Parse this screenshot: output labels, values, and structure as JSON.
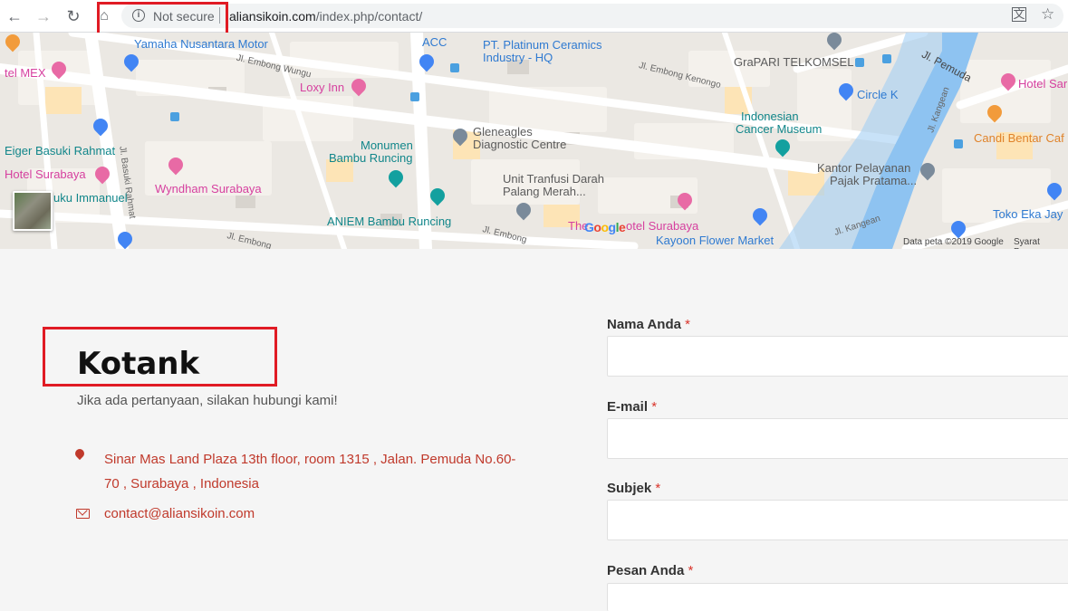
{
  "browser": {
    "security_label": "Not secure",
    "url_host": "aliansikoin.com",
    "url_path": "/index.php/contact/"
  },
  "map": {
    "places": [
      {
        "label": "Yamaha Nusantara Motor"
      },
      {
        "label": "ACC"
      },
      {
        "label": "PT. Platinum Ceramics"
      },
      {
        "label": "Industry - HQ"
      },
      {
        "label": "GraPARI TELKOMSEL"
      },
      {
        "label": "Jl. Pemuda"
      },
      {
        "label": "Hotel Sar"
      },
      {
        "label": "tel MEX"
      },
      {
        "label": "Loxy Inn"
      },
      {
        "label": "Circle K"
      },
      {
        "label": "Indonesian"
      },
      {
        "label": "Cancer Museum"
      },
      {
        "label": "Gleneagles"
      },
      {
        "label": "Diagnostic Centre"
      },
      {
        "label": "Candi Bentar Caf"
      },
      {
        "label": "Eiger Basuki Rahmat"
      },
      {
        "label": "Monumen"
      },
      {
        "label": "Bambu Runcing"
      },
      {
        "label": "Hotel Surabaya"
      },
      {
        "label": "Wyndham Surabaya"
      },
      {
        "label": "Kantor Pelayanan"
      },
      {
        "label": "Pajak Pratama..."
      },
      {
        "label": "Unit Tranfusi Darah"
      },
      {
        "label": "Palang Merah..."
      },
      {
        "label": "uku Immanuel"
      },
      {
        "label": "ANIEM Bambu Runcing"
      },
      {
        "label": "Toko Eka Jay"
      },
      {
        "label": "The"
      },
      {
        "label": "otel Surabaya"
      },
      {
        "label": "Kayoon Flower Market"
      }
    ],
    "streets": [
      "Jl. Embong Wungu",
      "Jl. Embong Kenongo",
      "Jl. Kangean",
      "Jl. Basuki Rahmat",
      "Jl. Embong",
      "Jl. Embong",
      "Jl. Kangean"
    ],
    "brand": "Google",
    "data_credit": "Data peta ©2019 Google",
    "terms": "Syarat Penggu"
  },
  "contact": {
    "title": "Kotank",
    "subtitle": "Jika ada pertanyaan, silakan hubungi kami!",
    "address": "Sinar Mas Land Plaza 13th floor, room 1315 , Jalan. Pemuda No.60-70 , Surabaya , Indonesia",
    "email": "contact@aliansikoin.com"
  },
  "form": {
    "name_label": "Nama Anda",
    "email_label": "E-mail",
    "subject_label": "Subjek",
    "message_label": "Pesan Anda",
    "required_mark": "*"
  },
  "colors": {
    "accent": "#c0392b",
    "highlight": "#e01b24"
  }
}
